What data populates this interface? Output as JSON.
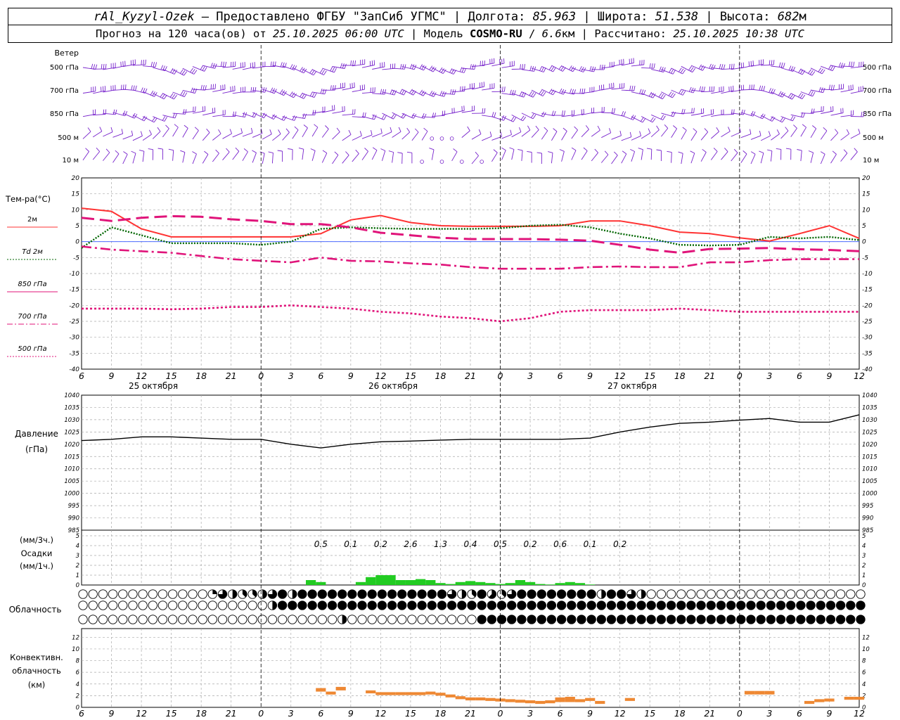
{
  "header": {
    "station": "rAl_Kyzyl-Ozek",
    "provider": "Предоставлено ФГБУ \"ЗапСиб УГМС\"",
    "lon_label": "Долгота:",
    "lon": "85.963",
    "lat_label": "Широта:",
    "lat": "51.538",
    "alt_label": "Высота:",
    "alt": "682",
    "alt_unit": "м",
    "forecast_label": "Прогноз на 120 часа(ов) от",
    "forecast_from": "25.10.2025 06:00 UTC",
    "model_label": "Модель",
    "model": "COSMO-RU",
    "model_res": "6.6",
    "model_res_unit": "км",
    "calc_label": "Рассчитано:",
    "calc_time": "25.10.2025 10:38 UTC"
  },
  "wind": {
    "title": "Ветер",
    "levels": [
      "500 гПа",
      "700 гПа",
      "850 гПа",
      "500 м",
      "10 м"
    ]
  },
  "temp": {
    "title": "Тем-ра(°C)",
    "ticks": [
      20,
      15,
      10,
      5,
      0,
      -5,
      -10,
      -15,
      -20,
      -25,
      -30,
      -35,
      -40
    ],
    "legend": [
      {
        "label": "2м",
        "color": "#ff3333",
        "style": "solid"
      },
      {
        "label": "Td  2м",
        "color": "#006600",
        "style": "dotted"
      },
      {
        "label": "850 гПа",
        "color": "#e0147a",
        "style": "dashed"
      },
      {
        "label": "700 гПа",
        "color": "#e0147a",
        "style": "dashdot"
      },
      {
        "label": "500 гПа",
        "color": "#e0147a",
        "style": "dotted"
      }
    ]
  },
  "time_axis": {
    "hours": [
      "6",
      "9",
      "12",
      "15",
      "18",
      "21",
      "0",
      "3",
      "6",
      "9",
      "12",
      "15",
      "18",
      "21",
      "0",
      "3",
      "6",
      "9",
      "12",
      "15",
      "18",
      "21",
      "0",
      "3",
      "6",
      "9",
      "12"
    ],
    "dates": [
      "25 октября",
      "26 октября",
      "27 октября"
    ]
  },
  "pressure": {
    "title1": "Давление",
    "title2": "(гПа)",
    "ticks": [
      1040,
      1035,
      1030,
      1025,
      1020,
      1015,
      1010,
      1005,
      1000,
      995,
      990,
      985
    ]
  },
  "precip": {
    "title1": "(мм/3ч.)",
    "title2": "Осадки",
    "title3": "(мм/1ч.)",
    "ticks": [
      5,
      4,
      3,
      2,
      1,
      0
    ],
    "totals": [
      "0.5",
      "0.1",
      "0.2",
      "2.6",
      "1.3",
      "0.4",
      "0.5",
      "0.2",
      "0.6",
      "0.1",
      "0.2"
    ]
  },
  "cloud": {
    "title": "Облачность"
  },
  "conv": {
    "title1": "Конвективн.",
    "title2": "облачность",
    "title3": "(км)",
    "ticks": [
      12,
      10,
      8,
      6,
      4,
      2,
      0
    ]
  },
  "chart_data": [
    {
      "type": "line",
      "title": "Тем-ра(°C)",
      "x_hours_from_start": [
        0,
        3,
        6,
        9,
        12,
        15,
        18,
        21,
        24,
        27,
        30,
        33,
        36,
        39,
        42,
        45,
        48,
        51,
        54,
        57,
        60,
        63,
        66,
        69,
        72,
        75,
        78
      ],
      "ylim": [
        -40,
        20
      ],
      "series": [
        {
          "name": "2м",
          "values": [
            10.5,
            9.5,
            4,
            1.5,
            1.5,
            1.5,
            1.5,
            1.5,
            2.5,
            6.8,
            8.2,
            6,
            5,
            4.8,
            4.8,
            4.8,
            5,
            6.5,
            6.5,
            5,
            3,
            2.5,
            1.2,
            0.2,
            2.5,
            5,
            1
          ]
        },
        {
          "name": "Td 2м",
          "values": [
            -2,
            4.5,
            2,
            -0.5,
            -0.5,
            -0.5,
            -1,
            0,
            4,
            4.5,
            4.2,
            4,
            4,
            4,
            4.2,
            5,
            5.3,
            4.5,
            2.5,
            1,
            -1,
            -1.2,
            -1,
            1.5,
            1,
            1.5,
            0.5
          ]
        },
        {
          "name": "850 гПа",
          "values": [
            7.5,
            6.5,
            7.5,
            8,
            7.8,
            7,
            6.5,
            5.5,
            5.5,
            4.5,
            2.8,
            2,
            1.2,
            0.8,
            0.8,
            0.8,
            0.6,
            0.3,
            -1,
            -2.5,
            -3.5,
            -2.3,
            -2.2,
            -2,
            -2.4,
            -2.6,
            -3
          ]
        },
        {
          "name": "700 гПа",
          "values": [
            -1.5,
            -2.5,
            -3,
            -3.5,
            -4.5,
            -5.5,
            -6,
            -6.5,
            -5,
            -6,
            -6.2,
            -6.8,
            -7.2,
            -8,
            -8.5,
            -8.5,
            -8.5,
            -8,
            -7.8,
            -8,
            -8,
            -6.5,
            -6.5,
            -5.8,
            -5.5,
            -5.5,
            -5.5
          ]
        },
        {
          "name": "500 гПа",
          "values": [
            -21,
            -21,
            -21,
            -21.2,
            -21,
            -20.5,
            -20.5,
            -20,
            -20.5,
            -21,
            -22,
            -22.5,
            -23.5,
            -24,
            -25,
            -24,
            -22,
            -21.5,
            -21.5,
            -21.5,
            -21,
            -21.5,
            -22,
            -22,
            -22,
            -22,
            -22
          ]
        }
      ]
    },
    {
      "type": "line",
      "title": "Давление",
      "x_hours_from_start": [
        0,
        3,
        6,
        9,
        12,
        15,
        18,
        21,
        24,
        27,
        30,
        33,
        36,
        39,
        42,
        45,
        48,
        51,
        54,
        57,
        60,
        63,
        66,
        69,
        72,
        75,
        78
      ],
      "ylim": [
        985,
        1040
      ],
      "series": [
        {
          "name": "Давление",
          "values": [
            1021.5,
            1022,
            1023,
            1023,
            1022.5,
            1022,
            1022,
            1020,
            1018.5,
            1020,
            1021,
            1021.3,
            1021.7,
            1022,
            1022,
            1022,
            1022,
            1022.5,
            1025,
            1027,
            1028.5,
            1029,
            1029.8,
            1030.5,
            1029,
            1029,
            1032
          ]
        }
      ]
    },
    {
      "type": "bar",
      "title": "Осадки",
      "x_hours_from_start": [
        23,
        24,
        28,
        29,
        30,
        31,
        32,
        33,
        34,
        35,
        36,
        37,
        38,
        39,
        40,
        41,
        42,
        43,
        44,
        45,
        46,
        47,
        48,
        49,
        50,
        51,
        52,
        53
      ],
      "values": [
        0.5,
        0.3,
        0.3,
        0.8,
        1,
        1,
        0.5,
        0.5,
        0.6,
        0.5,
        0.2,
        0.1,
        0.3,
        0.4,
        0.3,
        0.2,
        0.1,
        0.2,
        0.5,
        0.3,
        0.1,
        0.05,
        0.2,
        0.3,
        0.2,
        0.05,
        0,
        0
      ],
      "ylim": [
        0,
        5
      ]
    }
  ]
}
